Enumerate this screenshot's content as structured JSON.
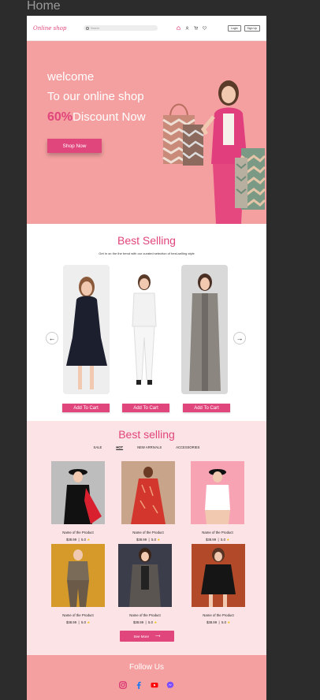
{
  "frame_label": "Home",
  "nav": {
    "logo": "Online shop",
    "search_placeholder": "Search",
    "login": "Login",
    "signup": "Sign Up"
  },
  "hero": {
    "line1": "welcome",
    "line2": "To our online shop",
    "discount_pct": "60%",
    "discount_text": "Discount Now",
    "cta": "Shop Now"
  },
  "best_selling_1": {
    "title": "Best Selling",
    "subtitle": "Get in on the the trend with our curated selection of best-selling style",
    "add_to_cart": "Add To Cart"
  },
  "best_selling_2": {
    "title": "Best selling",
    "tabs": [
      "SALE",
      "HOT",
      "NEW ARRIVALS",
      "ACCESSORIES"
    ],
    "active_tab": "HOT",
    "products": [
      {
        "name": "Name of the Product",
        "price": "$38.99",
        "rating": "5.0"
      },
      {
        "name": "Name of the Product",
        "price": "$38.99",
        "rating": "5.0"
      },
      {
        "name": "Name of the Product",
        "price": "$38.99",
        "rating": "5.0"
      },
      {
        "name": "Name of the Product",
        "price": "$38.99",
        "rating": "5.0"
      },
      {
        "name": "Name of the Product",
        "price": "$38.99",
        "rating": "5.0"
      },
      {
        "name": "Name of the Product",
        "price": "$38.99",
        "rating": "5.0"
      }
    ],
    "see_more": "See More"
  },
  "footer": {
    "title": "Follow Us"
  },
  "colors": {
    "accent": "#e0457b",
    "hero_bg": "#f4a0a0",
    "section_bg": "#fbe3e6"
  }
}
